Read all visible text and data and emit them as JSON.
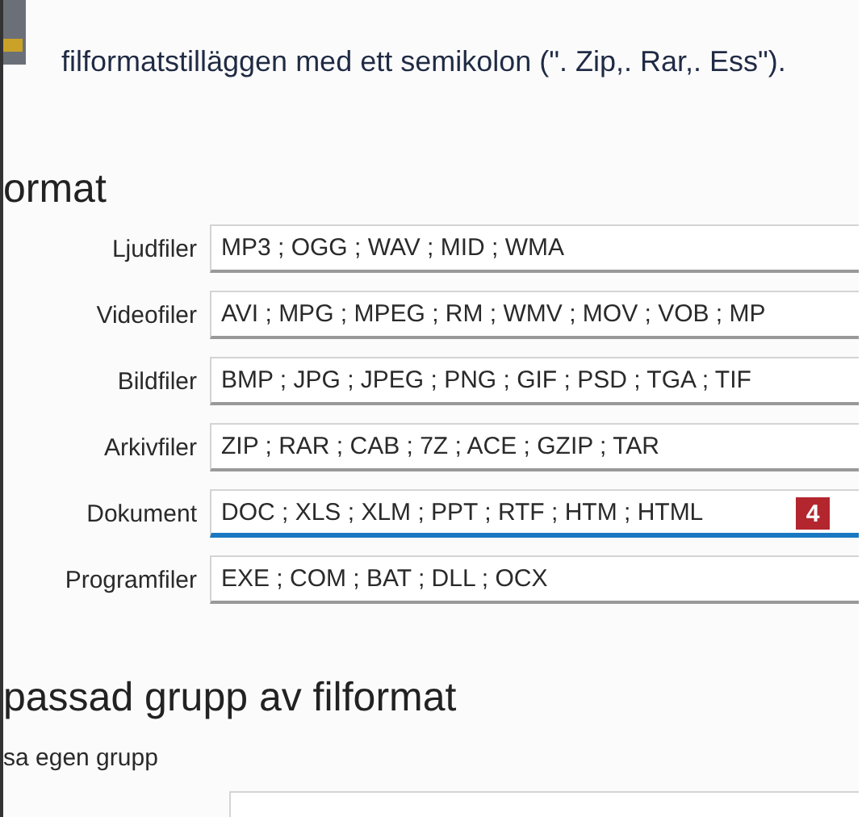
{
  "intro": "filformatstilläggen med ett semikolon (\". Zip,. Rar,. Ess\").",
  "section_heading": "ormat",
  "groups": [
    {
      "label": "Ljudfiler",
      "value": "MP3 ; OGG ; WAV ; MID ; WMA",
      "focused": false
    },
    {
      "label": "Videofiler",
      "value": "AVI ; MPG ; MPEG ; RM ; WMV ; MOV ; VOB ; MP",
      "focused": false
    },
    {
      "label": "Bildfiler",
      "value": "BMP ; JPG ; JPEG ; PNG ; GIF ; PSD ; TGA ; TIF",
      "focused": false
    },
    {
      "label": "Arkivfiler",
      "value": "ZIP ; RAR ; CAB ; 7Z ; ACE ; GZIP ; TAR",
      "focused": false
    },
    {
      "label": "Dokument",
      "value": "DOC ; XLS ; XLM ; PPT ; RTF ; HTM ; HTML",
      "focused": true,
      "badge": "4"
    },
    {
      "label": "Programfiler",
      "value": "EXE ; COM ; BAT ; DLL ; OCX",
      "focused": false
    }
  ],
  "custom_heading": "passad grupp av filformat",
  "custom_subtitle": "sa egen grupp"
}
